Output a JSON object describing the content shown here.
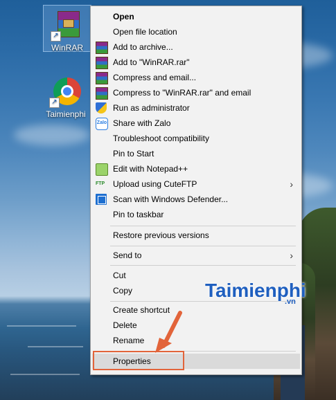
{
  "desktop": {
    "icons": [
      {
        "label": "WinRAR",
        "icon": "winrar-icon",
        "selected": true
      },
      {
        "label": "Taimienphi",
        "icon": "chrome-icon",
        "selected": false
      }
    ]
  },
  "context_menu": {
    "items": [
      {
        "label": "Open",
        "icon": null,
        "bold": true
      },
      {
        "label": "Open file location",
        "icon": null
      },
      {
        "label": "Add to archive...",
        "icon": "winrar-icon"
      },
      {
        "label": "Add to \"WinRAR.rar\"",
        "icon": "winrar-icon"
      },
      {
        "label": "Compress and email...",
        "icon": "winrar-icon"
      },
      {
        "label": "Compress to \"WinRAR.rar\" and email",
        "icon": "winrar-icon"
      },
      {
        "label": "Run as administrator",
        "icon": "shield-icon"
      },
      {
        "label": "Share with Zalo",
        "icon": "zalo-icon"
      },
      {
        "label": "Troubleshoot compatibility",
        "icon": null
      },
      {
        "label": "Pin to Start",
        "icon": null
      },
      {
        "label": "Edit with Notepad++",
        "icon": "notepadpp-icon"
      },
      {
        "label": "Upload using CuteFTP",
        "icon": "cuteftp-icon",
        "submenu": true
      },
      {
        "label": "Scan with Windows Defender...",
        "icon": "defender-icon"
      },
      {
        "label": "Pin to taskbar",
        "icon": null
      },
      {
        "label": "Restore previous versions",
        "icon": null
      },
      {
        "label": "Send to",
        "icon": null,
        "submenu": true
      },
      {
        "label": "Cut",
        "icon": null
      },
      {
        "label": "Copy",
        "icon": null
      },
      {
        "label": "Create shortcut",
        "icon": null
      },
      {
        "label": "Delete",
        "icon": null
      },
      {
        "label": "Rename",
        "icon": null
      },
      {
        "label": "Properties",
        "icon": null,
        "highlighted": true
      }
    ],
    "zalo_icon_text": "Zalo",
    "cuteftp_icon_text": "FTP"
  },
  "watermark": {
    "text": "Taimienphi",
    "sub": ".vn"
  },
  "colors": {
    "annotation": "#e2643a",
    "watermark": "#1f5fbf",
    "menu_bg": "#f2f2f2"
  }
}
